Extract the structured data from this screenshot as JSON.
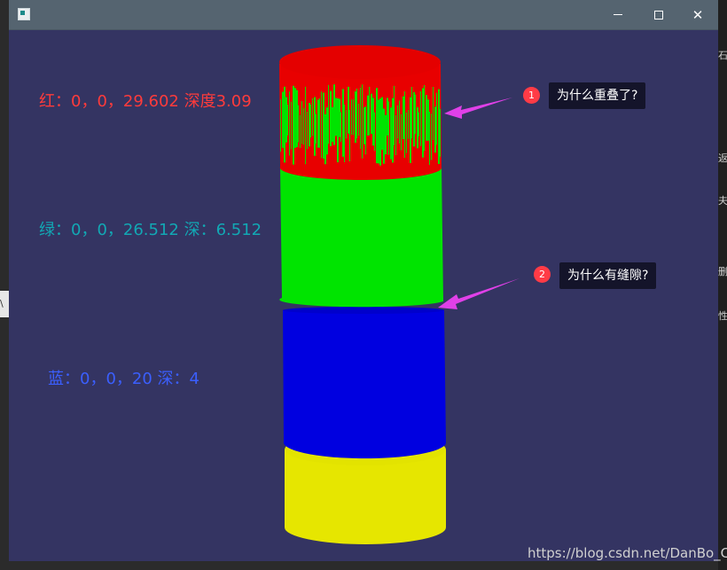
{
  "window": {
    "title_icon": "app-window-icon",
    "controls": [
      "minimize-icon",
      "maximize-icon",
      "close-icon"
    ]
  },
  "labels": {
    "red": "红：0，0，29.602  深度3.09",
    "green": "绿：0，0，26.512 深：6.512",
    "blue": "蓝：0，0，20  深：4"
  },
  "callouts": [
    {
      "number": "1",
      "text": "为什么重叠了?"
    },
    {
      "number": "2",
      "text": "为什么有缝隙?"
    }
  ],
  "host_fragments": {
    "left": "\\",
    "right": [
      "石",
      "返",
      "夫",
      "删",
      "性",
      "_C"
    ]
  },
  "watermark": "https://blog.csdn.net/DanBo_C",
  "colors": {
    "background": "#343462",
    "red": "#e80000",
    "green": "#00e400",
    "blue": "#0000e0",
    "yellow": "#e6e600",
    "arrow": "#e040e8"
  }
}
